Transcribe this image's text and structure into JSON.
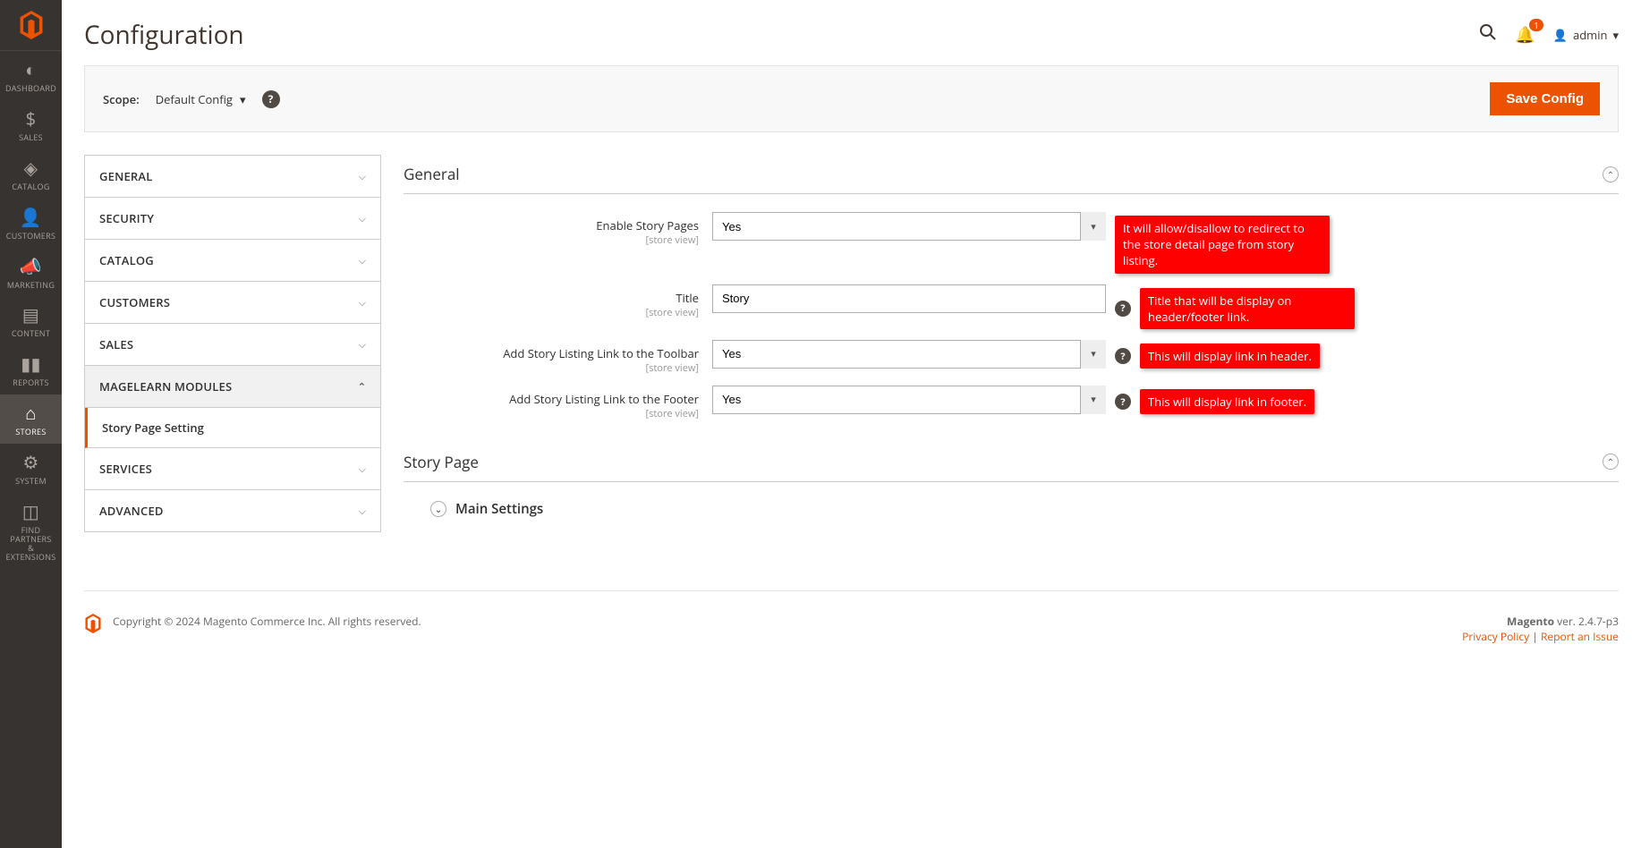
{
  "page_title": "Configuration",
  "sidebar": {
    "items": [
      {
        "label": "DASHBOARD",
        "icon": "dashboard"
      },
      {
        "label": "SALES",
        "icon": "dollar"
      },
      {
        "label": "CATALOG",
        "icon": "cube"
      },
      {
        "label": "CUSTOMERS",
        "icon": "person"
      },
      {
        "label": "MARKETING",
        "icon": "megaphone"
      },
      {
        "label": "CONTENT",
        "icon": "layers"
      },
      {
        "label": "REPORTS",
        "icon": "bars"
      },
      {
        "label": "STORES",
        "icon": "store"
      },
      {
        "label": "SYSTEM",
        "icon": "gear"
      },
      {
        "label": "FIND PARTNERS\n& EXTENSIONS",
        "icon": "handshake"
      }
    ]
  },
  "notifications": {
    "count": "1"
  },
  "admin": {
    "label": "admin"
  },
  "scope": {
    "label": "Scope:",
    "value": "Default Config"
  },
  "save_button": "Save Config",
  "config_tabs": [
    {
      "label": "GENERAL",
      "expanded": false
    },
    {
      "label": "SECURITY",
      "expanded": false
    },
    {
      "label": "CATALOG",
      "expanded": false
    },
    {
      "label": "CUSTOMERS",
      "expanded": false
    },
    {
      "label": "SALES",
      "expanded": false
    },
    {
      "label": "MAGELEARN MODULES",
      "expanded": true,
      "sub": [
        {
          "label": "Story Page Setting"
        }
      ]
    },
    {
      "label": "SERVICES",
      "expanded": false
    },
    {
      "label": "ADVANCED",
      "expanded": false
    }
  ],
  "sections": {
    "general": {
      "title": "General",
      "fields": [
        {
          "label": "Enable Story Pages",
          "scope": "[store view]",
          "value": "Yes",
          "type": "select",
          "callout": "It will allow/disallow to redirect to the store detail page from story listing."
        },
        {
          "label": "Title",
          "scope": "[store view]",
          "value": "Story",
          "type": "text",
          "callout": "Title that will be display on header/footer link.",
          "has_help": true
        },
        {
          "label": "Add Story Listing Link to the Toolbar",
          "scope": "[store view]",
          "value": "Yes",
          "type": "select",
          "callout": "This will display link in header.",
          "has_help": true
        },
        {
          "label": "Add Story Listing Link to the Footer",
          "scope": "[store view]",
          "value": "Yes",
          "type": "select",
          "callout": "This will display link in footer.",
          "has_help": true
        }
      ]
    },
    "story_page": {
      "title": "Story Page",
      "sub": {
        "title": "Main Settings"
      }
    }
  },
  "footer": {
    "copyright": "Copyright © 2024 Magento Commerce Inc. All rights reserved.",
    "product": "Magento",
    "version": " ver. 2.4.7-p3",
    "links": {
      "privacy": "Privacy Policy",
      "report": "Report an Issue"
    }
  }
}
